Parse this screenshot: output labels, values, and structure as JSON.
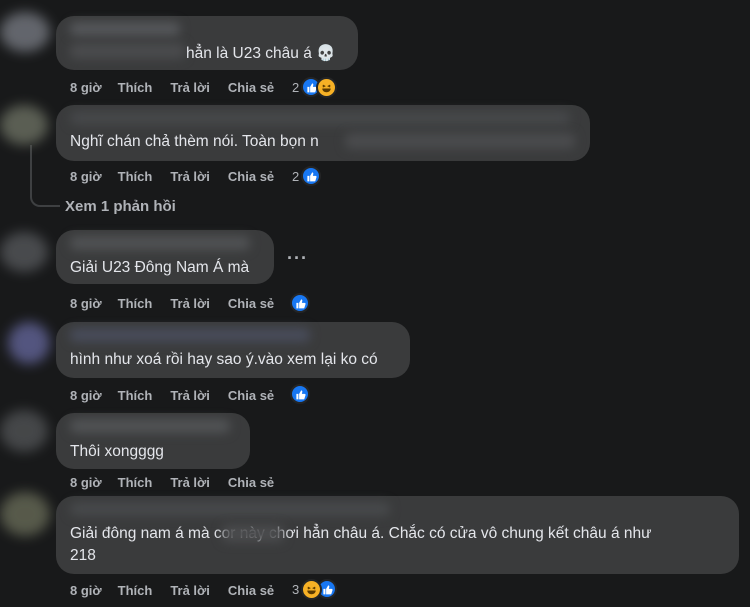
{
  "actions": {
    "like": "Thích",
    "reply": "Trả lời",
    "share": "Chia sẻ"
  },
  "view_replies": "Xem 1 phản hồi",
  "more_menu": "···",
  "comments": [
    {
      "text": "hẳn là U23 châu á 💀",
      "time": "8 giờ",
      "reaction_count": "2",
      "reactions": [
        "like-icon",
        "haha-icon"
      ]
    },
    {
      "text": "Nghĩ chán chả thèm nói. Toàn bọn n",
      "time": "8 giờ",
      "reaction_count": "2",
      "reactions": [
        "like-icon"
      ]
    },
    {
      "text": "Giải U23 Đông Nam Á mà",
      "time": "8 giờ",
      "reaction_count": "",
      "reactions": [
        "like-icon"
      ]
    },
    {
      "text": "hình như xoá rồi hay sao ý.vào xem lại ko có",
      "time": "8 giờ",
      "reaction_count": "",
      "reactions": [
        "like-icon"
      ]
    },
    {
      "text": "Thôi xongggg",
      "time": "8 giờ",
      "reaction_count": "",
      "reactions": []
    },
    {
      "text_line1": "Giải đông nam á mà cor        này chơi hẳn châu á. Chắc có cửa vô chung kết châu á như",
      "text_line2": "218",
      "time": "8 giờ",
      "reaction_count": "3",
      "reactions": [
        "haha-icon",
        "like-icon"
      ]
    }
  ],
  "colors": {
    "background": "#18191a",
    "bubble": "#3a3b3c",
    "like": "#1877f2",
    "haha": "#f7b125",
    "muted_text": "#b0b3b8"
  }
}
